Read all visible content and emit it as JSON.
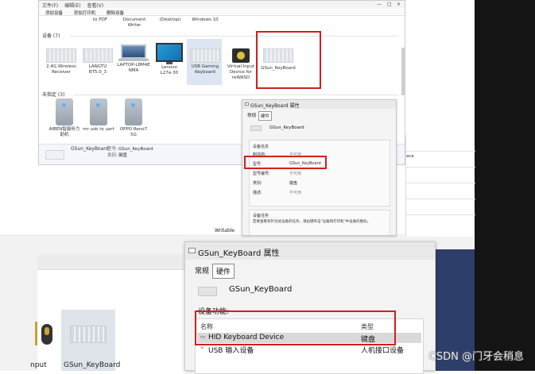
{
  "top_window": {
    "menu": [
      "文件(F)",
      "编辑(E)",
      "查看(V)"
    ],
    "toolbar": [
      "添加设备",
      "添加打印机",
      "删除设备"
    ],
    "controls": [
      "—",
      "□",
      "×"
    ],
    "printers_row": [
      "to PDF",
      "Document\nWriter",
      "(Desktop)",
      "Windows 10"
    ],
    "devices_section": "设备 (7)",
    "devices": [
      {
        "label": "2.4G Wireless\nReceiver",
        "icon": "keyboard-icon"
      },
      {
        "label": "LANGTU\nBT5.0_3",
        "icon": "keyboard-icon"
      },
      {
        "label": "LAPTOP-L8M4E\nNMA",
        "icon": "laptop-icon"
      },
      {
        "label": "Lenovo\nL27e-30",
        "icon": "monitor-icon"
      },
      {
        "label": "USB Gaming\nKeyboard",
        "icon": "keyboard-icon"
      },
      {
        "label": "Virtual Input\nDevice for\nreWASD",
        "icon": "gamepad-icon"
      },
      {
        "label": "GSun_KeyBoard",
        "icon": "keyboard-icon"
      }
    ],
    "unspecified_section": "未指定 (3)",
    "unspecified": [
      {
        "label": "AIBEN智能听力\n助机",
        "icon": "tower-icon"
      },
      {
        "label": "mr usb to uart",
        "icon": "tower-icon"
      },
      {
        "label": "OPPO Reno7\n5G",
        "icon": "tower-icon"
      }
    ],
    "details": {
      "name": "GSun_KeyBoard",
      "model_label": "型号:",
      "model_value": "GSun_KeyBoard",
      "category_label": "类别:",
      "category_value": "键盘"
    }
  },
  "mid_window": {
    "text": "ace"
  },
  "writable": "Writable",
  "props_small": {
    "title": "GSun_KeyBoard 属性",
    "tabs": [
      "常规",
      "硬件"
    ],
    "device_name": "GSun_KeyBoard",
    "info_group": "设备信息",
    "fields": [
      {
        "label": "制造商:",
        "value": "不可用"
      },
      {
        "label": "型号:",
        "value": "GSun_KeyBoard"
      },
      {
        "label": "型号编号:",
        "value": "不可用"
      },
      {
        "label": "类别:",
        "value": "键盘"
      },
      {
        "label": "描述:",
        "value": "不可用"
      }
    ],
    "tasks_group": "设备任务",
    "tasks_text": "若要查看有针对此设备的任务，请右键单击\"设备和打印机\"中设备的图标。"
  },
  "props_large": {
    "title": "GSun_KeyBoard 属性",
    "tabs": [
      "常规",
      "硬件"
    ],
    "device_name": "GSun_KeyBoard",
    "functions_label": "设备功能:",
    "col_name": "名称",
    "col_type": "类型",
    "rows": [
      {
        "name": "HID Keyboard Device",
        "type": "键盘"
      },
      {
        "name": "USB 输入设备",
        "type": "人机接口设备"
      }
    ]
  },
  "bottom_left": {
    "label_left": "nput",
    "label_right": "GSun_KeyBoard"
  },
  "watermark": "CSDN @门牙会稍息",
  "colors": {
    "highlight_box": "#d21f1f",
    "selection": "#dbe6f2"
  }
}
